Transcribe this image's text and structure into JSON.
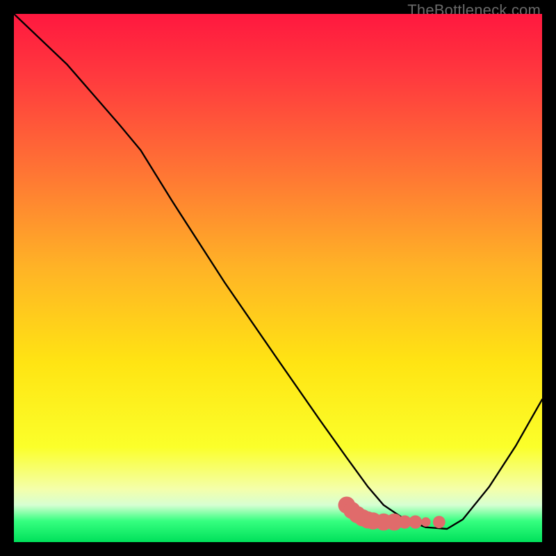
{
  "watermark": "TheBottleneck.com",
  "chart_data": {
    "type": "line",
    "title": "",
    "xlabel": "",
    "ylabel": "",
    "xlim": [
      0,
      100
    ],
    "ylim": [
      0,
      100
    ],
    "grid": false,
    "legend": false,
    "gradient_stops": [
      {
        "offset": 0,
        "color": "#ff183f"
      },
      {
        "offset": 12,
        "color": "#ff3a3e"
      },
      {
        "offset": 30,
        "color": "#ff7534"
      },
      {
        "offset": 48,
        "color": "#ffb326"
      },
      {
        "offset": 66,
        "color": "#ffe413"
      },
      {
        "offset": 82,
        "color": "#fbff2a"
      },
      {
        "offset": 90,
        "color": "#f4ffab"
      },
      {
        "offset": 93,
        "color": "#d6ffd2"
      },
      {
        "offset": 96,
        "color": "#36ff80"
      },
      {
        "offset": 100,
        "color": "#00e05a"
      }
    ],
    "series": [
      {
        "name": "curve",
        "color": "#000000",
        "x": [
          0,
          10,
          20,
          24,
          30,
          40,
          50,
          58,
          63,
          67,
          70,
          74,
          78,
          82,
          85,
          90,
          95,
          100
        ],
        "y": [
          100,
          90.5,
          79.0,
          74.2,
          64.5,
          49.0,
          34.5,
          23.0,
          16.0,
          10.5,
          7.0,
          4.3,
          2.8,
          2.5,
          4.3,
          10.5,
          18.2,
          27.0
        ]
      }
    ],
    "markers": {
      "name": "highlight",
      "color": "#e06b6b",
      "points": [
        {
          "x": 63,
          "y": 7.0,
          "r": 1.8
        },
        {
          "x": 64,
          "y": 6.0,
          "r": 1.8
        },
        {
          "x": 65,
          "y": 5.2,
          "r": 1.8
        },
        {
          "x": 66,
          "y": 4.6,
          "r": 1.8
        },
        {
          "x": 67,
          "y": 4.2,
          "r": 1.8
        },
        {
          "x": 68,
          "y": 4.0,
          "r": 1.8
        },
        {
          "x": 70,
          "y": 3.8,
          "r": 1.8
        },
        {
          "x": 72,
          "y": 3.8,
          "r": 1.8
        },
        {
          "x": 74,
          "y": 3.8,
          "r": 1.4
        },
        {
          "x": 76,
          "y": 3.8,
          "r": 1.4
        },
        {
          "x": 78,
          "y": 3.8,
          "r": 1.0
        },
        {
          "x": 80.5,
          "y": 3.8,
          "r": 1.3
        }
      ]
    }
  }
}
